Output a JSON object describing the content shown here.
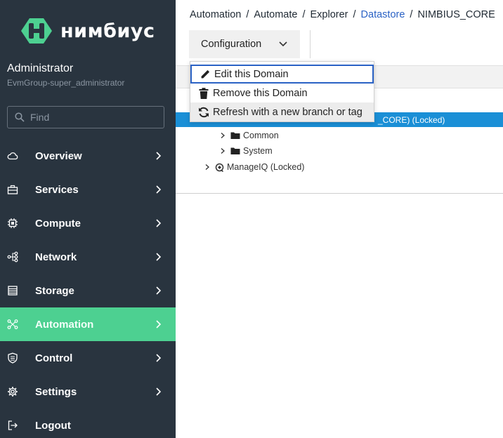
{
  "brand": {
    "name": "нимбиус",
    "logo_color": "#4dd091"
  },
  "user": {
    "name": "Administrator",
    "group": "EvmGroup-super_administrator"
  },
  "search": {
    "placeholder": "Find"
  },
  "nav": {
    "items": [
      {
        "label": "Overview",
        "icon": "cloud-icon",
        "active": false,
        "chevron": true
      },
      {
        "label": "Services",
        "icon": "briefcase-icon",
        "active": false,
        "chevron": true
      },
      {
        "label": "Compute",
        "icon": "chip-icon",
        "active": false,
        "chevron": true
      },
      {
        "label": "Network",
        "icon": "network-icon",
        "active": false,
        "chevron": true
      },
      {
        "label": "Storage",
        "icon": "storage-icon",
        "active": false,
        "chevron": true
      },
      {
        "label": "Automation",
        "icon": "automation-icon",
        "active": true,
        "chevron": true
      },
      {
        "label": "Control",
        "icon": "shield-icon",
        "active": false,
        "chevron": true
      },
      {
        "label": "Settings",
        "icon": "gear-icon",
        "active": false,
        "chevron": true
      },
      {
        "label": "Logout",
        "icon": "logout-icon",
        "active": false,
        "chevron": false
      }
    ],
    "active_color": "#4dd091"
  },
  "breadcrumb": {
    "items": [
      "Automation",
      "Automate",
      "Explorer",
      "Datastore",
      "NIMBIUS_CORE"
    ],
    "separator": "/",
    "link_color": "#2a62c5"
  },
  "toolbar": {
    "configuration_label": "Configuration"
  },
  "dropdown": {
    "items": [
      {
        "label": "Edit this Domain",
        "icon": "pencil-icon"
      },
      {
        "label": "Remove this Domain",
        "icon": "trash-icon"
      },
      {
        "label": "Refresh with a new branch or tag",
        "icon": "refresh-icon"
      }
    ]
  },
  "tree": {
    "selected_label": "_CORE) (Locked)",
    "selected_color": "#1a8fd6",
    "nodes": [
      {
        "label": "Common",
        "icon": "folder-icon"
      },
      {
        "label": "System",
        "icon": "folder-icon"
      },
      {
        "label": "ManageIQ (Locked)",
        "icon": "domain-icon"
      }
    ]
  }
}
